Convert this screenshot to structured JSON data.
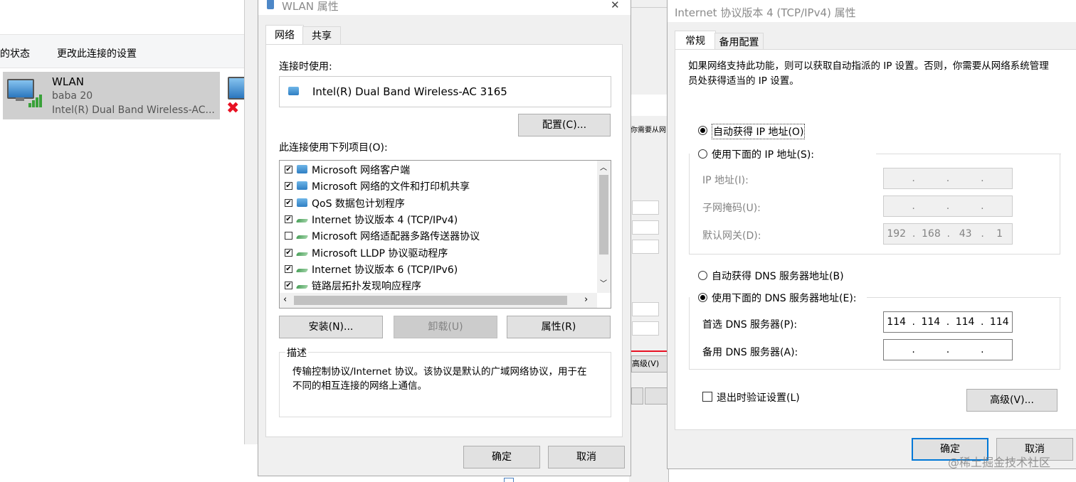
{
  "background_window": {
    "toolbar": {
      "status": "的状态",
      "change_settings": "更改此连接的设置"
    },
    "connection": {
      "name": "WLAN",
      "ssid": "baba 20",
      "adapter": "Intel(R) Dual Band Wireless-AC..."
    },
    "partial_text": "你需要从网",
    "partial_advanced": "高级(V)"
  },
  "wlan_dialog": {
    "title": "WLAN 属性",
    "close_glyph": "✕",
    "tabs": [
      "网络",
      "共享"
    ],
    "connect_using_label": "连接时使用:",
    "adapter_name": "Intel(R) Dual Band Wireless-AC 3165",
    "configure_button": "配置(C)...",
    "items_label": "此连接使用下列项目(O):",
    "items": [
      {
        "label": "Microsoft 网络客户端",
        "checked": true,
        "icon": "network-client-icon"
      },
      {
        "label": "Microsoft 网络的文件和打印机共享",
        "checked": true,
        "icon": "file-sharing-icon"
      },
      {
        "label": "QoS 数据包计划程序",
        "checked": true,
        "icon": "qos-icon"
      },
      {
        "label": "Internet 协议版本 4 (TCP/IPv4)",
        "checked": true,
        "icon": "protocol-icon"
      },
      {
        "label": "Microsoft 网络适配器多路传送器协议",
        "checked": false,
        "icon": "protocol-icon"
      },
      {
        "label": "Microsoft LLDP 协议驱动程序",
        "checked": true,
        "icon": "protocol-icon"
      },
      {
        "label": "Internet 协议版本 6 (TCP/IPv6)",
        "checked": true,
        "icon": "protocol-icon"
      },
      {
        "label": "链路层拓扑发现响应程序",
        "checked": true,
        "icon": "protocol-icon"
      }
    ],
    "install_button": "安装(N)...",
    "uninstall_button": "卸载(U)",
    "properties_button": "属性(R)",
    "description_label": "描述",
    "description_text": "传输控制协议/Internet 协议。该协议是默认的广域网络协议，用于在不同的相互连接的网络上通信。",
    "ok_button": "确定",
    "cancel_button": "取消"
  },
  "ipv4_dialog": {
    "title": "Internet 协议版本 4 (TCP/IPv4) 属性",
    "tabs": [
      "常规",
      "备用配置"
    ],
    "intro": "如果网络支持此功能，则可以获取自动指派的 IP 设置。否则，你需要从网络系统管理员处获得适当的 IP 设置。",
    "auto_ip": "自动获得 IP 地址(O)",
    "manual_ip": "使用下面的 IP 地址(S):",
    "ip_address_label": "IP 地址(I):",
    "subnet_label": "子网掩码(U):",
    "gateway_label": "默认网关(D):",
    "ip_address_value": [
      "",
      "",
      "",
      ""
    ],
    "subnet_value": [
      "",
      "",
      "",
      ""
    ],
    "gateway_value": [
      "192",
      "168",
      "43",
      "1"
    ],
    "auto_dns": "自动获得 DNS 服务器地址(B)",
    "manual_dns": "使用下面的 DNS 服务器地址(E):",
    "preferred_dns_label": "首选 DNS 服务器(P):",
    "alternate_dns_label": "备用 DNS 服务器(A):",
    "preferred_dns_value": [
      "114",
      "114",
      "114",
      "114"
    ],
    "alternate_dns_value": [
      "",
      "",
      "",
      ""
    ],
    "validate_checkbox": "退出时验证设置(L)",
    "advanced_button": "高级(V)...",
    "ok_button": "确定",
    "cancel_button": "取消",
    "selected_ip_mode": "auto",
    "selected_dns_mode": "manual"
  },
  "watermark": "@稀土掘金技术社区",
  "colors": {
    "accent": "#0078d7",
    "selection": "#cde8ff",
    "red_line": "#e81123"
  }
}
